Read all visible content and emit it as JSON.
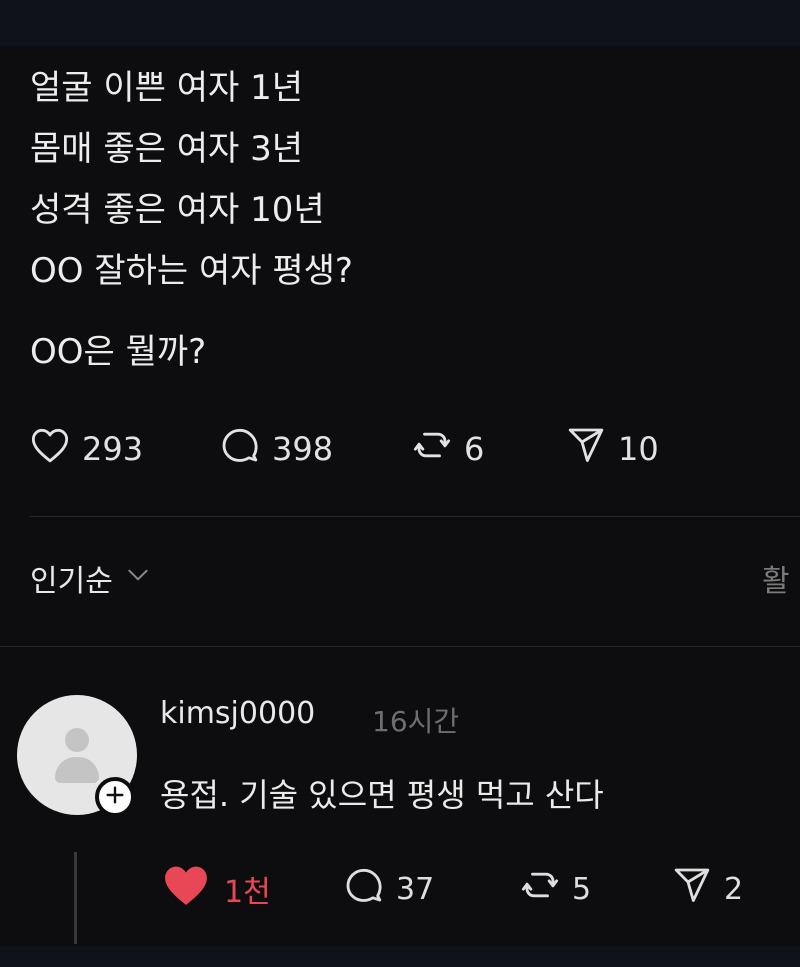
{
  "post": {
    "lines": [
      "얼굴 이쁜 여자 1년",
      "몸매 좋은 여자 3년",
      "성격 좋은 여자 10년",
      "OO 잘하는 여자 평생?"
    ],
    "question": "OO은 뭘까?",
    "stats": {
      "likes": "293",
      "comments": "398",
      "reposts": "6",
      "shares": "10"
    }
  },
  "sort": {
    "label": "인기순",
    "edge_text": "활"
  },
  "comment": {
    "username": "kimsj0000",
    "time": "16시간",
    "text": "용접. 기술 있으면 평생 먹고 산다",
    "stats": {
      "likes": "1천",
      "comments": "37",
      "reposts": "5",
      "shares": "2"
    }
  },
  "colors": {
    "background": "#0d0d0f",
    "text": "#ececec",
    "muted": "#6e6e72",
    "like_active": "#e84855"
  },
  "icons": [
    "heart-icon",
    "comment-icon",
    "repost-icon",
    "share-icon",
    "chevron-down-icon",
    "avatar-icon",
    "plus-icon"
  ]
}
